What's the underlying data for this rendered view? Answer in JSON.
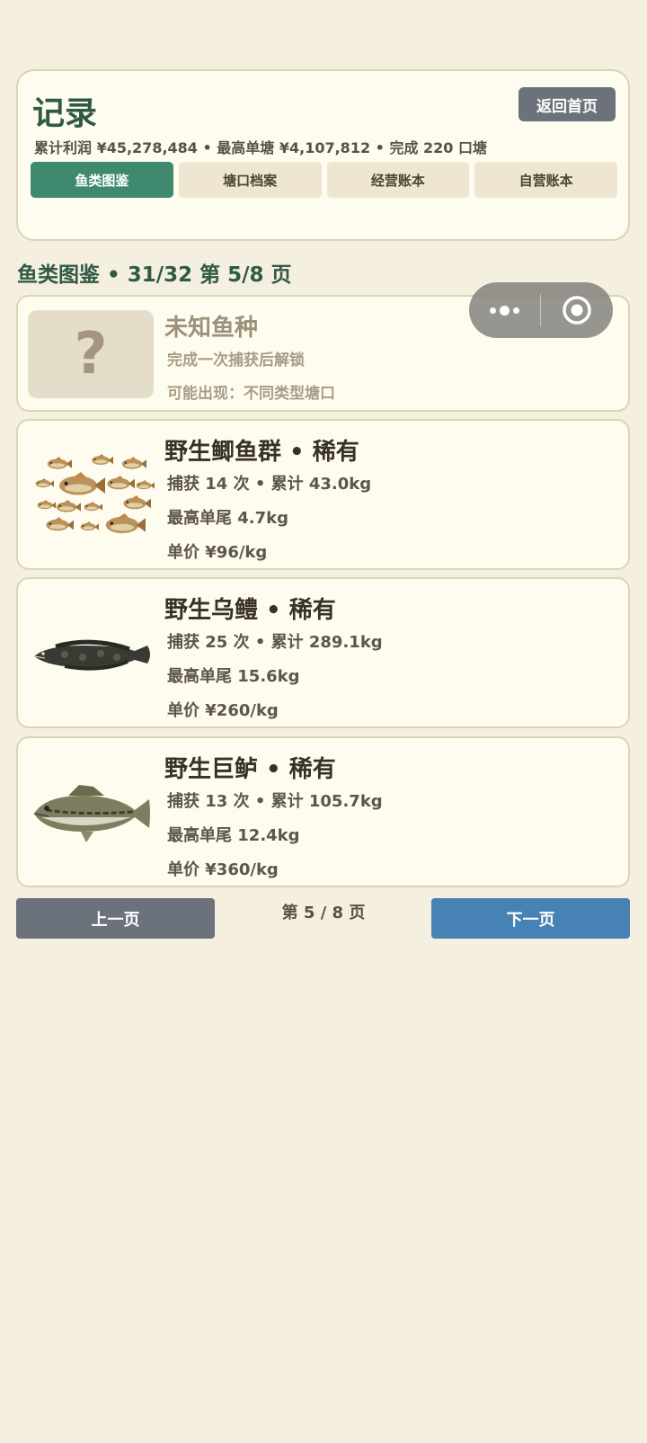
{
  "header": {
    "title": "记录",
    "home_button": "返回首页",
    "stats": "累计利润 ¥45,278,484 • 最高单塘 ¥4,107,812 • 完成 220 口塘",
    "tabs": [
      {
        "label": "鱼类图鉴",
        "active": true
      },
      {
        "label": "塘口档案",
        "active": false
      },
      {
        "label": "经营账本",
        "active": false
      },
      {
        "label": "自营账本",
        "active": false
      }
    ]
  },
  "section": {
    "title": "鱼类图鉴 • 31/32  第 5/8 页"
  },
  "capsule": {
    "menu_icon": "more-dots-icon",
    "close_icon": "target-circle-icon"
  },
  "fish": [
    {
      "name": "未知鱼种",
      "placeholder": "?",
      "line1": "完成一次捕获后解锁",
      "line2": "可能出现：不同类型塘口",
      "locked": true
    },
    {
      "name": "野生鲫鱼群 • 稀有",
      "line1": "捕获 14 次 • 累计 43.0kg",
      "line2": "最高单尾 4.7kg",
      "line3": "单价 ¥96/kg",
      "icon": "crucian-school-icon"
    },
    {
      "name": "野生乌鳢 • 稀有",
      "line1": "捕获 25 次 • 累计 289.1kg",
      "line2": "最高单尾 15.6kg",
      "line3": "单价 ¥260/kg",
      "icon": "snakehead-icon"
    },
    {
      "name": "野生巨鲈 • 稀有",
      "line1": "捕获 13 次 • 累计 105.7kg",
      "line2": "最高单尾 12.4kg",
      "line3": "单价 ¥360/kg",
      "icon": "bass-icon"
    }
  ],
  "pager": {
    "prev": "上一页",
    "indicator": "第 5 / 8 页",
    "next": "下一页"
  },
  "colors": {
    "background": "#f5efdf",
    "accent_green": "#3f8a6f",
    "title_green": "#2f5a44",
    "next_blue": "#4682b4",
    "gray_button": "#6c727b"
  }
}
